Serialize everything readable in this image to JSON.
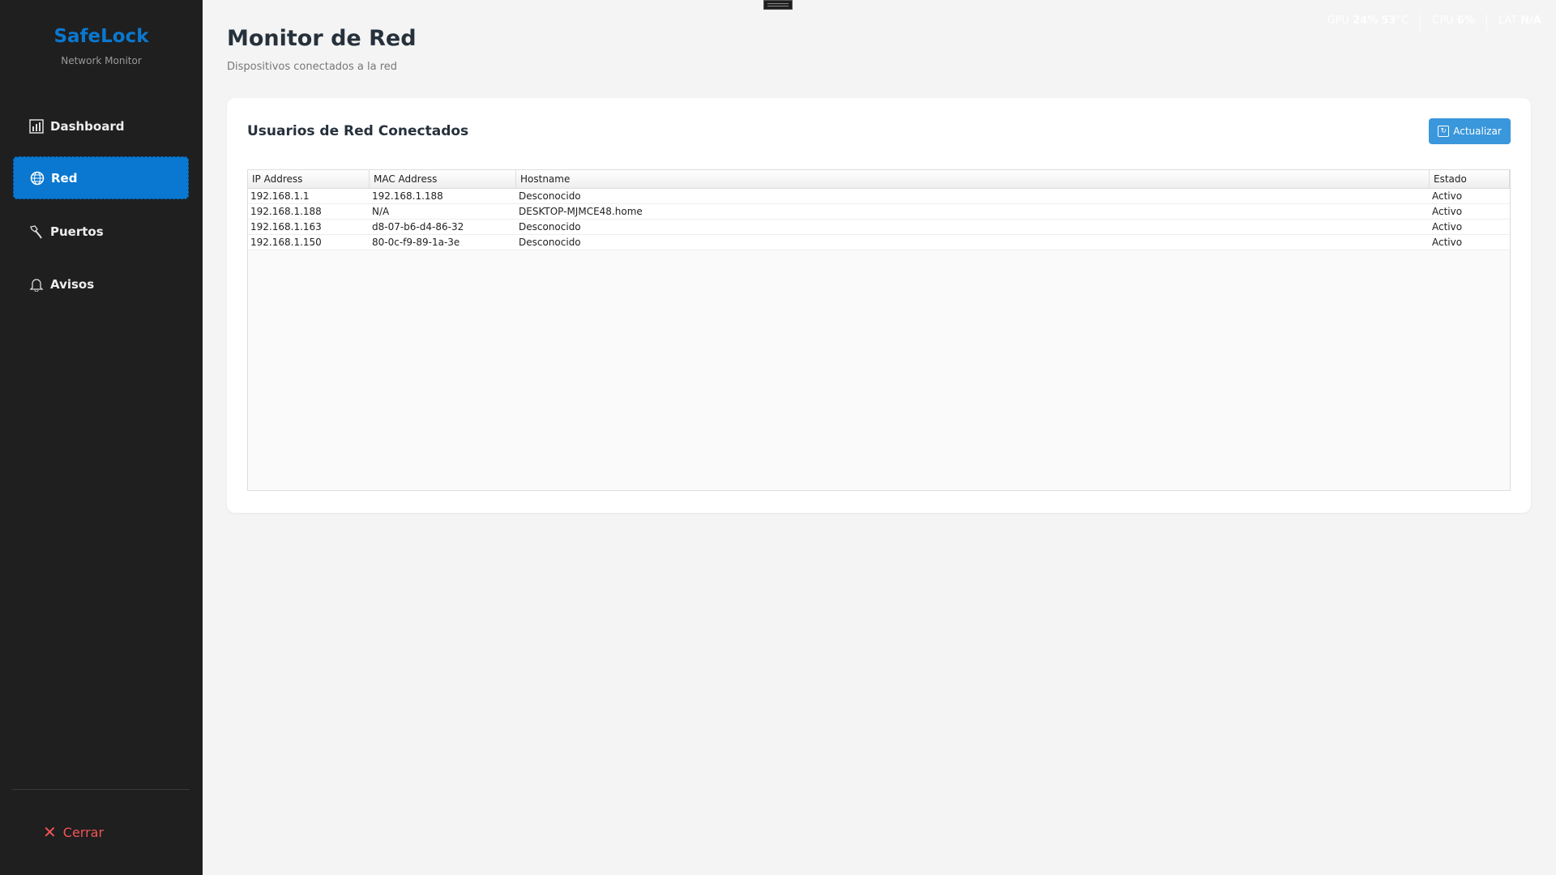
{
  "app": {
    "name": "SafeLock",
    "subtitle": "Network Monitor"
  },
  "sidebar": {
    "items": [
      {
        "label": "Dashboard",
        "icon": "bar-chart-icon"
      },
      {
        "label": "Red",
        "icon": "globe-icon",
        "active": true
      },
      {
        "label": "Puertos",
        "icon": "plug-icon"
      },
      {
        "label": "Avisos",
        "icon": "bell-icon"
      }
    ],
    "close_label": "Cerrar"
  },
  "stats": {
    "gpu_label": "GPU",
    "gpu_usage": "24",
    "gpu_usage_unit": "%",
    "gpu_temp": "53",
    "gpu_temp_unit": "°C",
    "cpu_label": "CPU",
    "cpu_usage": "6",
    "cpu_unit": "%",
    "lat_label": "LAT",
    "lat_value": "N/A"
  },
  "header": {
    "title": "Monitor de Red",
    "subtitle": "Dispositivos conectados a la red"
  },
  "card": {
    "title": "Usuarios de Red Conectados",
    "refresh_label": "Actualizar"
  },
  "table": {
    "columns": [
      "IP Address",
      "MAC Address",
      "Hostname",
      "Estado"
    ],
    "rows": [
      [
        "192.168.1.1",
        "192.168.1.188",
        "Desconocido",
        "Activo"
      ],
      [
        "192.168.1.188",
        "N/A",
        "DESKTOP-MJMCE48.home",
        "Activo"
      ],
      [
        "192.168.1.163",
        "d8-07-b6-d4-86-32",
        "Desconocido",
        "Activo"
      ],
      [
        "192.168.1.150",
        "80-0c-f9-89-1a-3e",
        "Desconocido",
        "Activo"
      ]
    ]
  },
  "colors": {
    "accent": "#0a78d0",
    "button": "#3a97db",
    "sidebar": "#1f1f1f",
    "danger": "#f05555"
  }
}
